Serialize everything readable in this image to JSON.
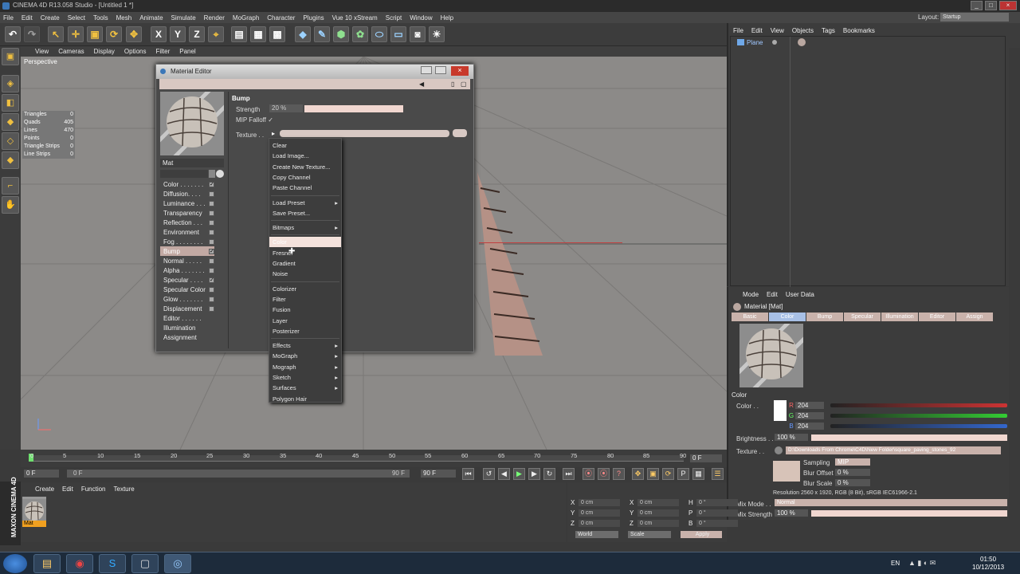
{
  "app": {
    "title": "CINEMA 4D R13.058 Studio - [Untitled 1 *]"
  },
  "menubar": [
    "File",
    "Edit",
    "Create",
    "Select",
    "Tools",
    "Mesh",
    "Animate",
    "Simulate",
    "Render",
    "MoGraph",
    "Character",
    "Plugins",
    "Vue 10 xStream",
    "Script",
    "Window",
    "Help"
  ],
  "layout": {
    "label": "Layout:",
    "value": "Startup"
  },
  "viewport": {
    "menu": [
      "View",
      "Cameras",
      "Display",
      "Options",
      "Filter",
      "Panel"
    ],
    "label": "Perspective",
    "stats": [
      {
        "k": "Triangles",
        "v": "0"
      },
      {
        "k": "Quads",
        "v": "405"
      },
      {
        "k": "Lines",
        "v": "470"
      },
      {
        "k": "Points",
        "v": "0"
      },
      {
        "k": "Triangle Strips",
        "v": "0"
      },
      {
        "k": "Line Strips",
        "v": "0"
      }
    ]
  },
  "material_editor": {
    "title": "Material Editor",
    "name": "Mat",
    "channels": [
      {
        "label": "Color . . . . . . .",
        "check": "✓"
      },
      {
        "label": "Diffusion. . . .",
        "check": ""
      },
      {
        "label": "Luminance . . .",
        "check": ""
      },
      {
        "label": "Transparency",
        "check": ""
      },
      {
        "label": "Reflection . . .",
        "check": ""
      },
      {
        "label": "Environment",
        "check": ""
      },
      {
        "label": "Fog . . . . . . . .",
        "check": ""
      },
      {
        "label": "Bump",
        "check": "✓"
      },
      {
        "label": "Normal . . . . .",
        "check": ""
      },
      {
        "label": "Alpha . . . . . . .",
        "check": ""
      },
      {
        "label": "Specular . . . .",
        "check": "✓"
      },
      {
        "label": "Specular Color",
        "check": ""
      },
      {
        "label": "Glow . . . . . . .",
        "check": ""
      },
      {
        "label": "Displacement",
        "check": ""
      },
      {
        "label": "Editor . . . . . .",
        "check": ""
      },
      {
        "label": "Illumination",
        "check": ""
      },
      {
        "label": "Assignment",
        "check": ""
      }
    ],
    "section": "Bump",
    "strength_label": "Strength",
    "strength_value": "20 %",
    "mip_label": "MIP Falloff",
    "mip_check": "✓",
    "texture_label": "Texture . ."
  },
  "popup": [
    {
      "label": "Clear",
      "sub": false
    },
    {
      "label": "Load Image...",
      "sub": false
    },
    {
      "label": "Create New Texture...",
      "sub": false
    },
    {
      "label": "Copy Channel",
      "sub": false
    },
    {
      "label": "Paste Channel",
      "sub": false
    },
    {
      "sep": true
    },
    {
      "label": "Load Preset",
      "sub": true
    },
    {
      "label": "Save Preset...",
      "sub": false
    },
    {
      "sep": true
    },
    {
      "label": "Bitmaps",
      "sub": true
    },
    {
      "sep": true
    },
    {
      "label": "Color",
      "sub": false,
      "hl": true
    },
    {
      "label": "Fresnel",
      "sub": false
    },
    {
      "label": "Gradient",
      "sub": false
    },
    {
      "label": "Noise",
      "sub": false
    },
    {
      "sep": true
    },
    {
      "label": "Colorizer",
      "sub": false
    },
    {
      "label": "Filter",
      "sub": false
    },
    {
      "label": "Fusion",
      "sub": false
    },
    {
      "label": "Layer",
      "sub": false
    },
    {
      "label": "Posterizer",
      "sub": false
    },
    {
      "sep": true
    },
    {
      "label": "Effects",
      "sub": true
    },
    {
      "label": "MoGraph",
      "sub": true
    },
    {
      "label": "Mograph",
      "sub": true
    },
    {
      "label": "Sketch",
      "sub": true
    },
    {
      "label": "Surfaces",
      "sub": true
    },
    {
      "label": "Polygon Hair",
      "sub": false
    }
  ],
  "objects": {
    "menu": [
      "File",
      "Edit",
      "View",
      "Objects",
      "Tags",
      "Bookmarks"
    ],
    "items": [
      "Plane"
    ]
  },
  "attributes": {
    "menu": [
      "Mode",
      "Edit",
      "User Data"
    ],
    "title": "Material [Mat]",
    "tabs": [
      "Basic",
      "Color",
      "Bump",
      "Specular",
      "Illumination",
      "Editor",
      "Assign"
    ],
    "color_head": "Color",
    "color_label": "Color . .",
    "r": "204",
    "g": "204",
    "b": "204",
    "brightness_label": "Brightness . .",
    "brightness_value": "100 %",
    "texture_label": "Texture . .",
    "texture_path": "D:\\Downloads From Chrome\\C4D\\New Folder\\square_paving_stones_92",
    "sampling_label": "Sampling",
    "sampling_value": "MIP",
    "blur_offset_label": "Blur Offset",
    "blur_offset_value": "0 %",
    "blur_scale_label": "Blur Scale",
    "blur_scale_value": "0 %",
    "resolution": "Resolution 2560 x 1920, RGB (8 Bit), sRGB IEC61966-2.1",
    "mix_mode_label": "Mix Mode . .",
    "mix_mode_value": "Normal",
    "mix_strength_label": "Mix Strength",
    "mix_strength_value": "100 %"
  },
  "timeline": {
    "ticks": [
      "0",
      "5",
      "10",
      "15",
      "20",
      "25",
      "30",
      "35",
      "40",
      "45",
      "50",
      "55",
      "60",
      "65",
      "70",
      "75",
      "80",
      "85",
      "90"
    ],
    "frame": "0 F",
    "start": "0 F",
    "current": "0 F",
    "end": "90 F",
    "end2": "90 F"
  },
  "material_manager": {
    "menu": [
      "Create",
      "Edit",
      "Function",
      "Texture"
    ],
    "mat_name": "Mat"
  },
  "coords": {
    "rows": [
      [
        "X",
        "0 cm",
        "X",
        "0 cm",
        "H",
        "0 °"
      ],
      [
        "Y",
        "0 cm",
        "Y",
        "0 cm",
        "P",
        "0 °"
      ],
      [
        "Z",
        "0 cm",
        "Z",
        "0 cm",
        "B",
        "0 °"
      ]
    ],
    "world": "World",
    "scale": "Scale",
    "apply": "Apply"
  },
  "brand": "MAXON CINEMA 4D",
  "taskbar": {
    "lang": "EN",
    "time": "01:50",
    "date": "10/12/2013"
  },
  "colors": {
    "accent": "#f1d7d0",
    "highlight": "#f4e2dc",
    "tab_active": "#a8c0e6"
  }
}
